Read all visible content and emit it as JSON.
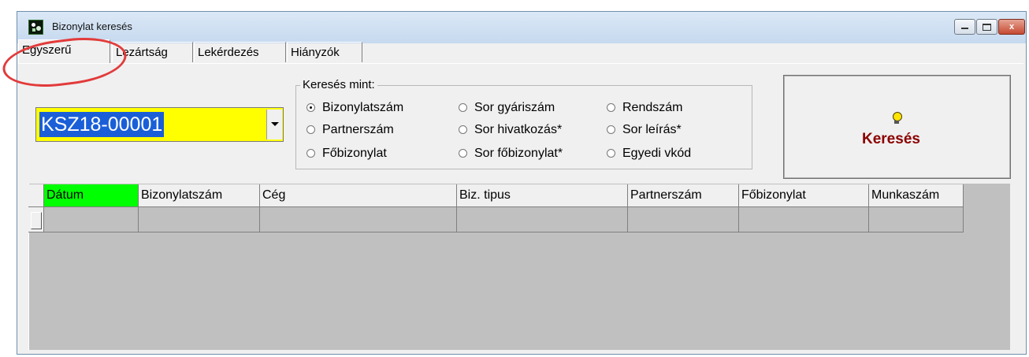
{
  "window": {
    "title": "Bizonylat keresés",
    "controls": {
      "minimize": "",
      "maximize": "",
      "close": "x"
    }
  },
  "tabs": [
    {
      "label": "Egyszerű",
      "active": true
    },
    {
      "label": "Lezártság",
      "active": false
    },
    {
      "label": "Lekérdezés",
      "active": false
    },
    {
      "label": "Hiányzók",
      "active": false
    }
  ],
  "document_combo": {
    "value": "KSZ18-00001",
    "bg_color": "#ffff00"
  },
  "search_as": {
    "legend": "Keresés mint:",
    "options": [
      {
        "label": "Bizonylatszám",
        "checked": true
      },
      {
        "label": "Partnerszám",
        "checked": false
      },
      {
        "label": "Főbizonylat",
        "checked": false
      },
      {
        "label": "Sor gyáriszám",
        "checked": false
      },
      {
        "label": "Sor hivatkozás*",
        "checked": false
      },
      {
        "label": "Sor főbizonylat*",
        "checked": false
      },
      {
        "label": "Rendszám",
        "checked": false
      },
      {
        "label": "Sor leírás*",
        "checked": false
      },
      {
        "label": "Egyedi vkód",
        "checked": false
      }
    ]
  },
  "search_button": {
    "label": "Keresés",
    "icon": "lightbulb-icon",
    "text_color": "#8b0000"
  },
  "grid": {
    "columns": [
      "Dátum",
      "Bizonylatszám",
      "Cég",
      "Biz. tipus",
      "Partnerszám",
      "Főbizonylat",
      "Munkaszám"
    ],
    "sorted_column_color": "#00ff00",
    "rows": [
      [
        "",
        "",
        "",
        "",
        "",
        "",
        ""
      ]
    ]
  },
  "highlight_color": "#e23b3b"
}
